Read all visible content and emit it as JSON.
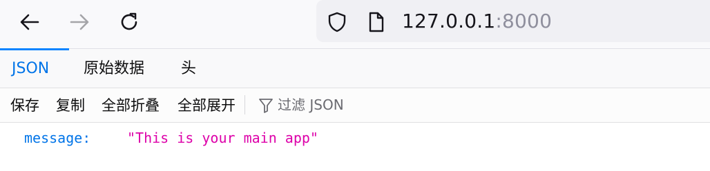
{
  "browser": {
    "url_host": "127.0.0.1",
    "url_port": ":8000",
    "icons": {
      "back": "back-arrow-icon",
      "forward": "forward-arrow-icon",
      "reload": "reload-icon",
      "security": "shield-icon",
      "page": "page-icon"
    }
  },
  "viewer": {
    "tabs": [
      {
        "label": "JSON",
        "selected": true
      },
      {
        "label": "原始数据",
        "selected": false
      },
      {
        "label": "头",
        "selected": false
      }
    ],
    "actions": {
      "save": "保存",
      "copy": "复制",
      "collapse_all": "全部折叠",
      "expand_all": "全部展开"
    },
    "filter_placeholder": "过滤 JSON"
  },
  "json": {
    "rows": [
      {
        "key": "message:",
        "value": "This is your main app"
      }
    ]
  },
  "colors": {
    "accent": "#0a84ff",
    "key": "#0074e8",
    "string": "#dd00a9"
  }
}
